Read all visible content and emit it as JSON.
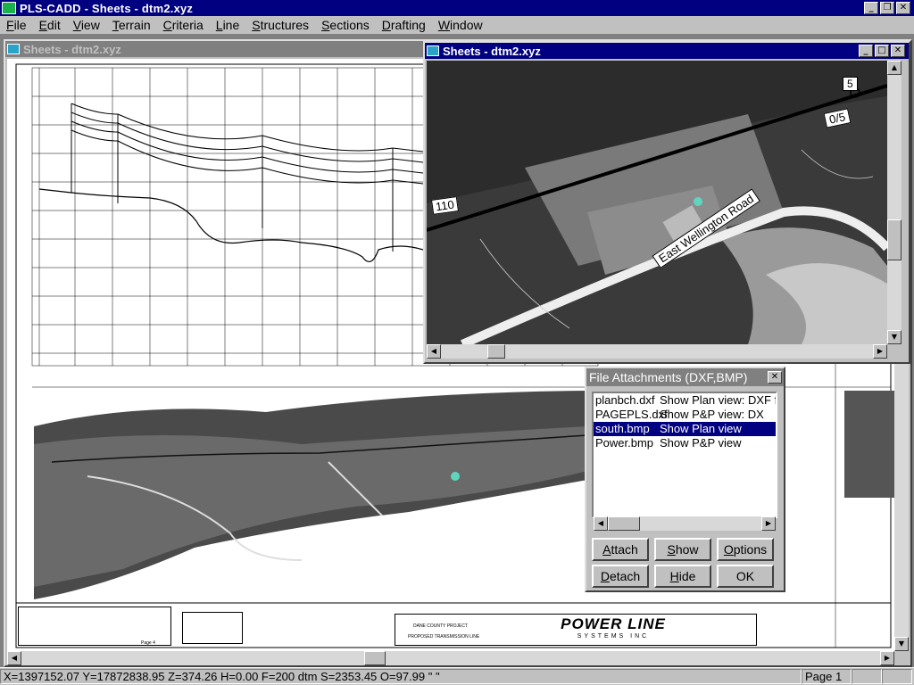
{
  "app": {
    "title": "PLS-CADD - Sheets - dtm2.xyz",
    "accent": "#000080"
  },
  "menu": [
    {
      "label": "File",
      "ul": "F",
      "rest": "ile"
    },
    {
      "label": "Edit",
      "ul": "E",
      "rest": "dit"
    },
    {
      "label": "View",
      "ul": "V",
      "rest": "iew"
    },
    {
      "label": "Terrain",
      "ul": "T",
      "rest": "errain"
    },
    {
      "label": "Criteria",
      "ul": "C",
      "rest": "riteria"
    },
    {
      "label": "Line",
      "ul": "L",
      "rest": "ine"
    },
    {
      "label": "Structures",
      "ul": "S",
      "rest": "tructures"
    },
    {
      "label": "Sections",
      "ul": "S",
      "rest": "ections"
    },
    {
      "label": "Drafting",
      "ul": "D",
      "rest": "rafting"
    },
    {
      "label": "Window",
      "ul": "W",
      "rest": "indow"
    }
  ],
  "windows": {
    "back_sheet_title": "Sheets - dtm2.xyz",
    "front_sheet_title": "Sheets - dtm2.xyz"
  },
  "plan_labels": {
    "road": "East Wellington Road",
    "station_110": "110",
    "struct_5": "5",
    "struct_05": "0/5"
  },
  "title_block": {
    "project": "DANE COUNTY PROJECT",
    "subject": "PROPOSED TRANSMISSION LINE",
    "logo_top": "POWER LINE",
    "logo_bottom": "SYSTEMS INC",
    "page": "Page 4"
  },
  "dialog": {
    "title": "File Attachments (DXF,BMP)",
    "items": [
      {
        "file": "planbch.dxf",
        "action": "Show Plan view: DXF f",
        "selected": false
      },
      {
        "file": "PAGEPLS.dxf",
        "action": "Show P&P view: DX",
        "selected": false
      },
      {
        "file": "south.bmp",
        "action": "Show Plan view",
        "selected": true
      },
      {
        "file": "Power.bmp",
        "action": "Show P&P view",
        "selected": false
      }
    ],
    "buttons": {
      "attach": {
        "ul": "A",
        "rest": "ttach"
      },
      "show": {
        "ul": "S",
        "rest": "how"
      },
      "options": {
        "ul": "O",
        "rest": "ptions"
      },
      "detach": {
        "ul": "D",
        "rest": "etach"
      },
      "hide": {
        "ul": "H",
        "rest": "ide"
      },
      "ok": "OK"
    }
  },
  "status": {
    "coords": "X=1397152.07 Y=17872838.95 Z=374.26 H=0.00 F=200 dtm S=2353.45 O=97.99 \" \"",
    "page": "Page 1"
  }
}
